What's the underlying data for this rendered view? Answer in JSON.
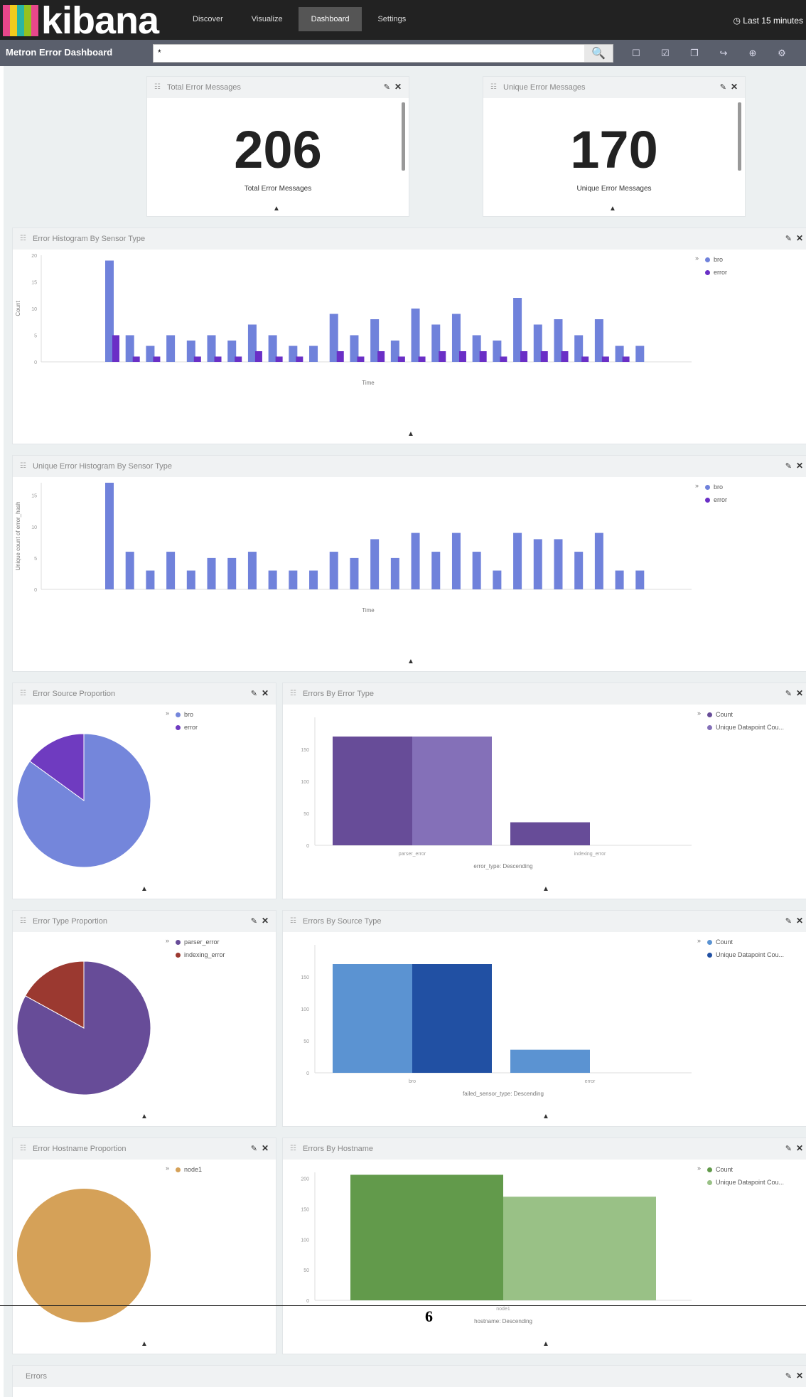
{
  "app": {
    "logo_text": "kibana",
    "stripe_colors": [
      "#e8478b",
      "#f2cb1d",
      "#2ab5a4",
      "#95c120",
      "#e8478b"
    ],
    "nav_tabs": [
      {
        "label": "Discover",
        "active": false
      },
      {
        "label": "Visualize",
        "active": false
      },
      {
        "label": "Dashboard",
        "active": true
      },
      {
        "label": "Settings",
        "active": false
      }
    ],
    "time_picker": "Last 15 minutes",
    "dashboard_title": "Metron Error Dashboard",
    "search_value": "*",
    "toolbar_icons": [
      "new-dashboard-icon",
      "save-icon",
      "load-icon",
      "share-icon",
      "add-visualization-icon",
      "options-icon"
    ]
  },
  "panels": {
    "total_errors": {
      "title": "Total Error Messages",
      "value": "206",
      "label": "Total Error Messages"
    },
    "unique_errors": {
      "title": "Unique Error Messages",
      "value": "170",
      "label": "Unique Error Messages"
    },
    "error_histogram": {
      "title": "Error Histogram By Sensor Type"
    },
    "unique_histogram": {
      "title": "Unique Error Histogram By Sensor Type"
    },
    "source_proportion": {
      "title": "Error Source Proportion"
    },
    "errors_by_type": {
      "title": "Errors By Error Type"
    },
    "type_proportion": {
      "title": "Error Type Proportion"
    },
    "errors_by_source": {
      "title": "Errors By Source Type"
    },
    "hostname_proportion": {
      "title": "Error Hostname Proportion"
    },
    "errors_by_hostname": {
      "title": "Errors By Hostname"
    },
    "errors": {
      "title": "Errors"
    }
  },
  "page_number": "6",
  "chart_data": [
    {
      "type": "bar",
      "name_key": "error_histogram",
      "title": "Error Histogram By Sensor Type",
      "ylabel": "Count",
      "xlabel": "Time",
      "ylim": [
        0,
        20
      ],
      "yticks": [
        0,
        5,
        10,
        15,
        20
      ],
      "x": [
        1,
        2,
        3,
        4,
        5,
        6,
        7,
        8,
        9,
        10,
        11,
        12,
        13,
        14,
        15,
        16,
        17,
        18,
        19,
        20,
        21,
        22,
        23,
        24,
        25,
        26
      ],
      "series": [
        {
          "name": "bro",
          "color": "#7082db",
          "values": [
            19,
            5,
            3,
            5,
            4,
            5,
            4,
            7,
            5,
            3,
            3,
            9,
            5,
            8,
            4,
            10,
            7,
            9,
            5,
            4,
            12,
            7,
            8,
            5,
            8,
            3,
            3
          ]
        },
        {
          "name": "error",
          "color": "#6a2fc6",
          "values": [
            5,
            1,
            1,
            0,
            1,
            1,
            1,
            2,
            1,
            1,
            0,
            2,
            1,
            2,
            1,
            1,
            2,
            2,
            2,
            1,
            2,
            2,
            2,
            1,
            1,
            1,
            0
          ]
        }
      ],
      "legend": [
        "bro",
        "error"
      ],
      "legend_position": "top-right"
    },
    {
      "type": "bar",
      "name_key": "unique_histogram",
      "title": "Unique Error Histogram By Sensor Type",
      "ylabel": "Unique count of error_hash",
      "xlabel": "Time",
      "ylim": [
        0,
        17
      ],
      "yticks": [
        0,
        5,
        10,
        15
      ],
      "series": [
        {
          "name": "bro",
          "color": "#7082db",
          "values": [
            17,
            6,
            3,
            6,
            3,
            5,
            5,
            6,
            3,
            3,
            3,
            6,
            5,
            8,
            5,
            9,
            6,
            9,
            6,
            3,
            9,
            8,
            8,
            6,
            9,
            3,
            3
          ]
        },
        {
          "name": "error",
          "color": "#6a2fc6",
          "values": [
            0,
            0,
            0,
            0,
            0,
            0,
            0,
            0,
            0,
            0,
            0,
            0,
            0,
            0,
            0,
            0,
            0,
            0,
            0,
            0,
            0,
            0,
            0,
            0,
            0,
            0,
            0
          ]
        }
      ],
      "legend": [
        "bro",
        "error"
      ],
      "legend_position": "top-right"
    },
    {
      "type": "pie",
      "name_key": "source_proportion",
      "title": "Error Source Proportion",
      "slices": [
        {
          "label": "bro",
          "value": 85,
          "color": "#7486db"
        },
        {
          "label": "error",
          "value": 15,
          "color": "#6f3bc0"
        }
      ]
    },
    {
      "type": "bar",
      "name_key": "errors_by_type",
      "title": "Errors By Error Type",
      "xlabel": "error_type: Descending",
      "ylim": [
        0,
        200
      ],
      "yticks": [
        0,
        50,
        100,
        150
      ],
      "categories": [
        "parser_error",
        "indexing_error"
      ],
      "series": [
        {
          "name": "Count",
          "color": "#674c98",
          "values": [
            170,
            36
          ]
        },
        {
          "name": "Unique Datapoint Cou...",
          "color": "#8470b8",
          "values": [
            170,
            0
          ]
        }
      ]
    },
    {
      "type": "pie",
      "name_key": "type_proportion",
      "title": "Error Type Proportion",
      "slices": [
        {
          "label": "parser_error",
          "value": 83,
          "color": "#674c98"
        },
        {
          "label": "indexing_error",
          "value": 17,
          "color": "#9b3930"
        }
      ]
    },
    {
      "type": "bar",
      "name_key": "errors_by_source",
      "title": "Errors By Source Type",
      "xlabel": "failed_sensor_type: Descending",
      "ylim": [
        0,
        200
      ],
      "yticks": [
        0,
        50,
        100,
        150
      ],
      "categories": [
        "bro",
        "error"
      ],
      "series": [
        {
          "name": "Count",
          "color": "#5b93d2",
          "values": [
            170,
            36
          ]
        },
        {
          "name": "Unique Datapoint Cou...",
          "color": "#2150a3",
          "values": [
            170,
            0
          ]
        }
      ]
    },
    {
      "type": "pie",
      "name_key": "hostname_proportion",
      "title": "Error Hostname Proportion",
      "slices": [
        {
          "label": "node1",
          "value": 100,
          "color": "#d5a158"
        }
      ]
    },
    {
      "type": "bar",
      "name_key": "errors_by_hostname",
      "title": "Errors By Hostname",
      "xlabel": "hostname: Descending",
      "ylim": [
        0,
        210
      ],
      "yticks": [
        0,
        50,
        100,
        150,
        200
      ],
      "categories": [
        "node1"
      ],
      "series": [
        {
          "name": "Count",
          "color": "#629a4b",
          "values": [
            206
          ]
        },
        {
          "name": "Unique Datapoint Cou...",
          "color": "#99c186",
          "values": [
            170
          ]
        }
      ]
    }
  ]
}
